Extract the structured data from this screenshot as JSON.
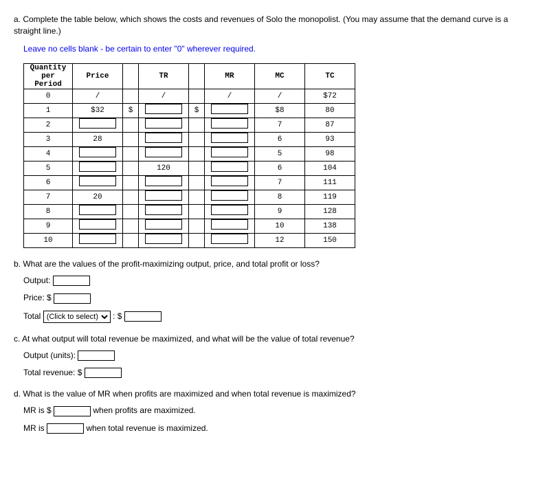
{
  "a_text": "a. Complete the table below, which shows the costs and revenues of Solo the monopolist. (You may assume that the demand curve is a straight line.)",
  "blue_text": "Leave no cells blank - be certain to enter \"0\" wherever required.",
  "headers": {
    "q": "Quantity\nper Period",
    "p": "Price",
    "tr": "TR",
    "mr": "MR",
    "mc": "MC",
    "tc": "TC"
  },
  "dollar": "$",
  "slash": "/",
  "rows": [
    {
      "q": "0",
      "p": "/",
      "tr": "/",
      "mr": "/",
      "mc": "/",
      "tc": "$72"
    },
    {
      "q": "1",
      "p": "$32",
      "tr": "",
      "mr": "",
      "mc": "$8",
      "tc": "80"
    },
    {
      "q": "2",
      "p": "",
      "tr": "",
      "mr": "",
      "mc": "7",
      "tc": "87"
    },
    {
      "q": "3",
      "p": "28",
      "tr": "",
      "mr": "",
      "mc": "6",
      "tc": "93"
    },
    {
      "q": "4",
      "p": "",
      "tr": "",
      "mr": "",
      "mc": "5",
      "tc": "98"
    },
    {
      "q": "5",
      "p": "",
      "tr": "120",
      "mr": "",
      "mc": "6",
      "tc": "104"
    },
    {
      "q": "6",
      "p": "",
      "tr": "",
      "mr": "",
      "mc": "7",
      "tc": "111"
    },
    {
      "q": "7",
      "p": "20",
      "tr": "",
      "mr": "",
      "mc": "8",
      "tc": "119"
    },
    {
      "q": "8",
      "p": "",
      "tr": "",
      "mr": "",
      "mc": "9",
      "tc": "128"
    },
    {
      "q": "9",
      "p": "",
      "tr": "",
      "mr": "",
      "mc": "10",
      "tc": "138"
    },
    {
      "q": "10",
      "p": "",
      "tr": "",
      "mr": "",
      "mc": "12",
      "tc": "150"
    }
  ],
  "b_text": "b. What are the values of the profit-maximizing output, price, and total profit or loss?",
  "b_output_label": "Output:",
  "b_price_label": "Price: $",
  "b_total_label": "Total",
  "b_select_placeholder": "(Click to select)",
  "b_colon_dollar": ": $",
  "c_text": "c. At what output will total revenue be maximized, and what will be the value of total revenue?",
  "c_output_label": "Output (units):",
  "c_tr_label": "Total revenue: $",
  "d_text": "d. What is the value of MR when profits are maximized and when total revenue is maximized?",
  "d_mr1_pre": "MR is $",
  "d_mr1_post": " when profits are maximized.",
  "d_mr2_pre": "MR is ",
  "d_mr2_post": " when total revenue is maximized."
}
